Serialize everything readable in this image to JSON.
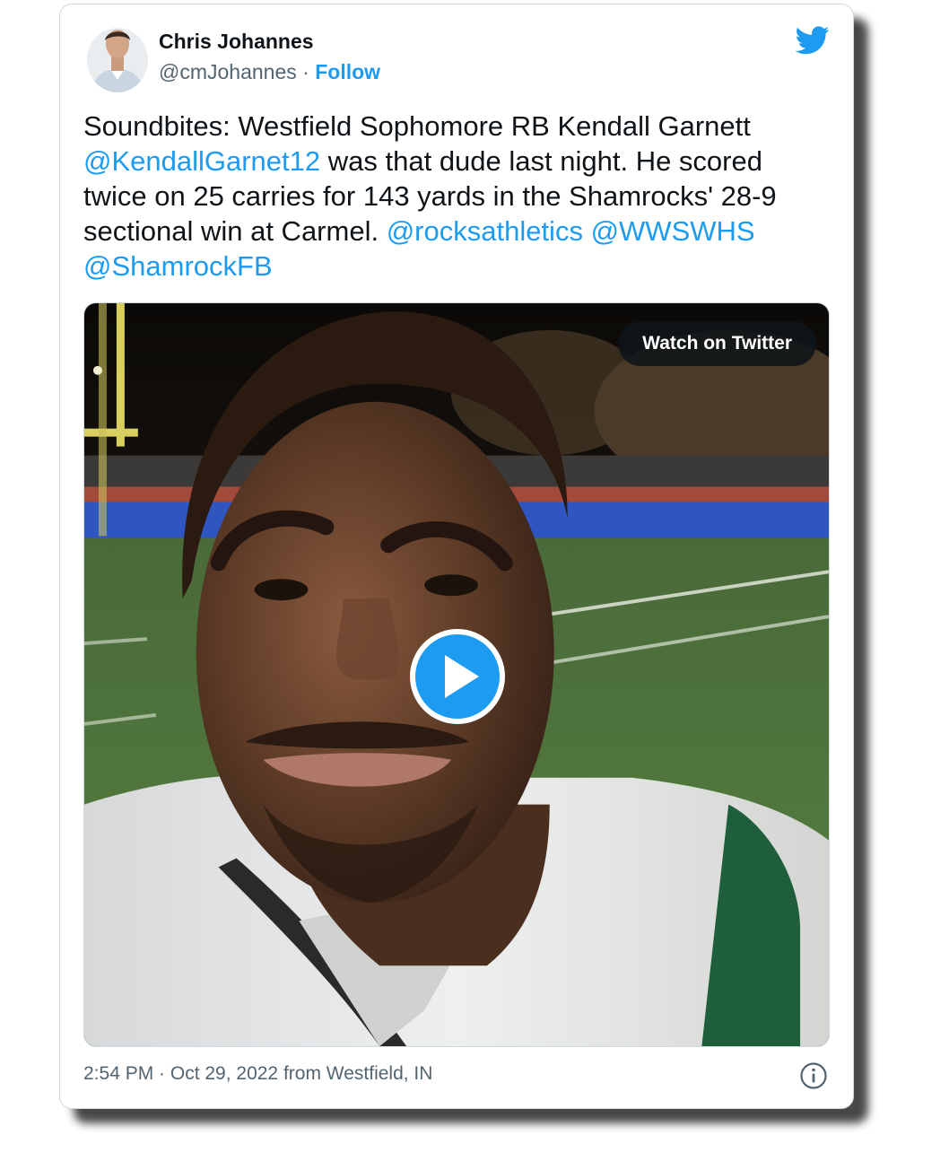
{
  "author": {
    "name": "Chris Johannes",
    "handle": "@cmJohannes",
    "separator": "·",
    "follow_label": "Follow",
    "avatar_icon": "avatar",
    "logo_icon": "twitter-bird-icon"
  },
  "tweet": {
    "text_part1": "Soundbites: Westfield Sophomore RB Kendall Garnett ",
    "mention1": "@KendallGarnet12",
    "text_part2": " was that dude last night. He scored twice on 25 carries for 143 yards in the Shamrocks' 28-9 sectional win at Carmel. ",
    "mention2": "@rocksathletics",
    "space": " ",
    "mention3": "@WWSWHS",
    "mention4": "@ShamrockFB"
  },
  "media": {
    "watch_label": "Watch on Twitter",
    "play_icon": "play-icon",
    "accent_color": "#1d9bf0"
  },
  "footer": {
    "timestamp": "2:54 PM · Oct 29, 2022 from Westfield, IN",
    "info_icon": "info-icon"
  }
}
